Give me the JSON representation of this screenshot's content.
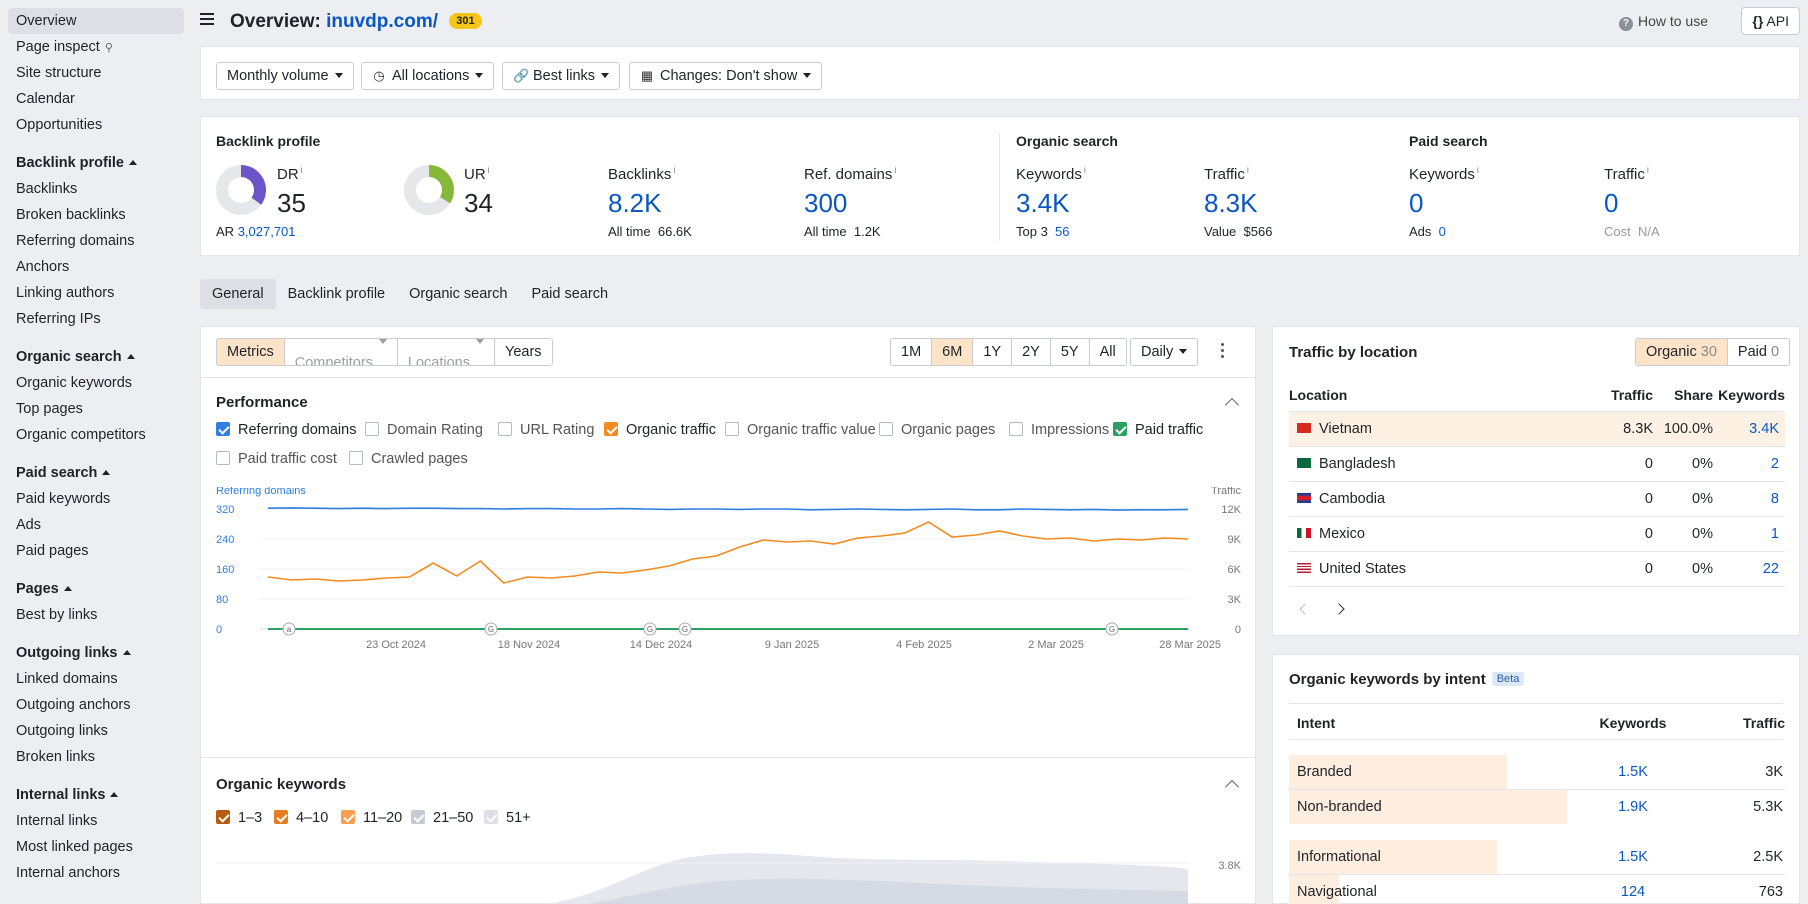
{
  "sidebar": {
    "top_items": [
      "Overview",
      "Page inspect",
      "Site structure",
      "Calendar",
      "Opportunities"
    ],
    "sections": [
      {
        "title": "Backlink profile",
        "items": [
          "Backlinks",
          "Broken backlinks",
          "Referring domains",
          "Anchors",
          "Linking authors",
          "Referring IPs"
        ]
      },
      {
        "title": "Organic search",
        "items": [
          "Organic keywords",
          "Top pages",
          "Organic competitors"
        ]
      },
      {
        "title": "Paid search",
        "items": [
          "Paid keywords",
          "Ads",
          "Paid pages"
        ]
      },
      {
        "title": "Pages",
        "items": [
          "Best by links"
        ]
      },
      {
        "title": "Outgoing links",
        "items": [
          "Linked domains",
          "Outgoing anchors",
          "Outgoing links",
          "Broken links"
        ]
      },
      {
        "title": "Internal links",
        "items": [
          "Internal links",
          "Most linked pages",
          "Internal anchors"
        ]
      }
    ]
  },
  "header": {
    "title_prefix": "Overview:",
    "domain": "inuvdp.com/",
    "badge": "301",
    "how_to_use": "How to use",
    "api": "API"
  },
  "filters": {
    "volume": "Monthly volume",
    "locations": "All locations",
    "links": "Best links",
    "changes": "Changes: Don't show"
  },
  "metrics": {
    "backlink_profile": {
      "title": "Backlink profile",
      "dr": {
        "label": "DR",
        "value": "35",
        "score": 35
      },
      "ar_label": "AR",
      "ar_value": "3,027,701",
      "ur": {
        "label": "UR",
        "value": "34",
        "score": 34
      },
      "backlinks": {
        "label": "Backlinks",
        "value": "8.2K",
        "sub_label": "All time",
        "sub_value": "66.6K"
      },
      "ref_domains": {
        "label": "Ref. domains",
        "value": "300",
        "sub_label": "All time",
        "sub_value": "1.2K"
      }
    },
    "organic_search": {
      "title": "Organic search",
      "keywords": {
        "label": "Keywords",
        "value": "3.4K",
        "sub_label": "Top 3",
        "sub_value": "56"
      },
      "traffic": {
        "label": "Traffic",
        "value": "8.3K",
        "sub_label": "Value",
        "sub_value": "$566"
      }
    },
    "paid_search": {
      "title": "Paid search",
      "keywords": {
        "label": "Keywords",
        "value": "0",
        "sub_label": "Ads",
        "sub_value": "0"
      },
      "traffic": {
        "label": "Traffic",
        "value": "0",
        "sub_label": "Cost",
        "sub_value": "N/A"
      }
    },
    "info_mark": "i"
  },
  "tabs": [
    "General",
    "Backlink profile",
    "Organic search",
    "Paid search"
  ],
  "chart_toolbar": {
    "modes": [
      "Metrics",
      "Competitors",
      "Locations",
      "Years"
    ],
    "ranges": [
      "1M",
      "6M",
      "1Y",
      "2Y",
      "5Y",
      "All"
    ],
    "active_range": "6M",
    "granularity": "Daily"
  },
  "performance": {
    "title": "Performance",
    "checkboxes": [
      {
        "label": "Referring domains",
        "checked": true,
        "color": "#2f7fe0"
      },
      {
        "label": "Domain Rating",
        "checked": false
      },
      {
        "label": "URL Rating",
        "checked": false
      },
      {
        "label": "Organic traffic",
        "checked": true,
        "color": "#f58a1f"
      },
      {
        "label": "Organic traffic value",
        "checked": false
      },
      {
        "label": "Organic pages",
        "checked": false
      },
      {
        "label": "Impressions",
        "checked": false
      },
      {
        "label": "Paid traffic",
        "checked": true,
        "color": "#2aa062"
      },
      {
        "label": "Paid traffic cost",
        "checked": false
      },
      {
        "label": "Crawled pages",
        "checked": false
      }
    ]
  },
  "chart_data": {
    "type": "line",
    "left_axis_label": "Referring domains",
    "right_axis_label": "Traffic",
    "left_ticks": [
      "320",
      "240",
      "160",
      "80",
      "0"
    ],
    "right_ticks": [
      "12K",
      "9K",
      "6K",
      "3K",
      "0"
    ],
    "x_ticks": [
      "23 Oct 2024",
      "18 Nov 2024",
      "14 Dec 2024",
      "9 Jan 2025",
      "4 Feb 2025",
      "2 Mar 2025",
      "28 Mar 2025"
    ],
    "ylim_left": [
      0,
      320
    ],
    "ylim_right": [
      0,
      12000
    ],
    "annotation_markers": [
      "a",
      "G",
      "G",
      "G",
      "G"
    ],
    "series": [
      {
        "name": "Referring domains",
        "axis": "left",
        "color": "#2f7fe0",
        "values": [
          322,
          323,
          322,
          321,
          322,
          321,
          322,
          322,
          321,
          321,
          320,
          321,
          321,
          320,
          320,
          321,
          320,
          319,
          320,
          320,
          319,
          320,
          320,
          318,
          319,
          320,
          319,
          318,
          319,
          320,
          318,
          318,
          320,
          319,
          318,
          319,
          317,
          318,
          318,
          319
        ]
      },
      {
        "name": "Organic traffic",
        "axis": "right",
        "color": "#f58a1f",
        "values": [
          5200,
          4900,
          5000,
          4800,
          4900,
          5100,
          5200,
          6600,
          5300,
          6800,
          4600,
          5200,
          5100,
          5300,
          5700,
          5600,
          5900,
          6300,
          7000,
          7300,
          8200,
          8900,
          8700,
          8800,
          8500,
          9100,
          9300,
          9600,
          10700,
          9200,
          9400,
          9800,
          9300,
          9000,
          9100,
          8800,
          9000,
          8900,
          9100,
          9000
        ]
      },
      {
        "name": "Paid traffic",
        "axis": "right",
        "color": "#2aa062",
        "values": [
          0,
          0,
          0,
          0,
          0,
          0,
          0,
          0,
          0,
          0,
          0,
          0,
          0,
          0,
          0,
          0,
          0,
          0,
          0,
          0,
          0,
          0,
          0,
          0,
          0,
          0,
          0,
          0,
          0,
          0,
          0,
          0,
          0,
          0,
          0,
          0,
          0,
          0,
          0,
          0
        ]
      }
    ]
  },
  "organic_keywords": {
    "title": "Organic keywords",
    "buckets": [
      {
        "label": "1–3",
        "color": "#b35c12",
        "checked": true
      },
      {
        "label": "4–10",
        "color": "#e57e20",
        "checked": true
      },
      {
        "label": "11–20",
        "color": "#f5a04e",
        "checked": true
      },
      {
        "label": "21–50",
        "color": "#c5cbd4",
        "checked": true
      },
      {
        "label": "51+",
        "color": "#dde1e7",
        "checked": true
      }
    ],
    "right_tick": "3.8K"
  },
  "traffic_by_location": {
    "title": "Traffic by location",
    "toggle": [
      {
        "label": "Organic",
        "count": "30",
        "active": true
      },
      {
        "label": "Paid",
        "count": "0",
        "active": false
      }
    ],
    "columns": [
      "Location",
      "Traffic",
      "Share",
      "Keywords"
    ],
    "rows": [
      {
        "country": "Vietnam",
        "traffic": "8.3K",
        "share": "100.0%",
        "keywords": "3.4K",
        "highlight": true
      },
      {
        "country": "Bangladesh",
        "traffic": "0",
        "share": "0%",
        "keywords": "2"
      },
      {
        "country": "Cambodia",
        "traffic": "0",
        "share": "0%",
        "keywords": "8"
      },
      {
        "country": "Mexico",
        "traffic": "0",
        "share": "0%",
        "keywords": "1"
      },
      {
        "country": "United States",
        "traffic": "0",
        "share": "0%",
        "keywords": "22"
      }
    ]
  },
  "keywords_by_intent": {
    "title": "Organic keywords by intent",
    "beta": "Beta",
    "columns": [
      "Intent",
      "Keywords",
      "Traffic"
    ],
    "rows": [
      {
        "intent": "Branded",
        "keywords": "1.5K",
        "traffic": "3K",
        "share": 0.44
      },
      {
        "intent": "Non-branded",
        "keywords": "1.9K",
        "traffic": "5.3K",
        "share": 0.56
      },
      {
        "intent": "Informational",
        "keywords": "1.5K",
        "traffic": "2.5K",
        "share": 0.42
      },
      {
        "intent": "Navigational",
        "keywords": "124",
        "traffic": "763",
        "share": 0.1
      }
    ]
  }
}
